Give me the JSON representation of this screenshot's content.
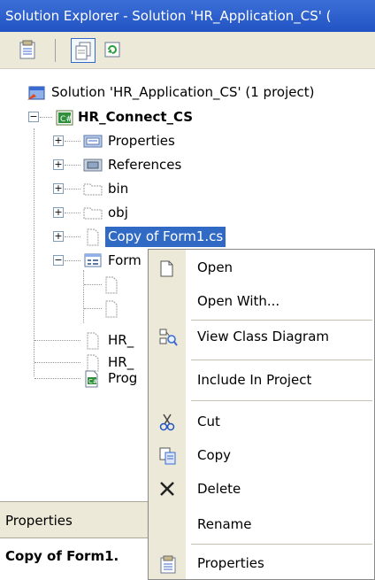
{
  "window": {
    "title": "Solution Explorer - Solution 'HR_Application_CS' ("
  },
  "toolbar": {
    "buttons": [
      {
        "icon": "properties-icon"
      },
      {
        "icon": "show-all-files-icon",
        "pressed": true
      },
      {
        "icon": "refresh-icon"
      }
    ]
  },
  "tree": {
    "solution": "Solution 'HR_Application_CS' (1 project)",
    "project": "HR_Connect_CS",
    "items": [
      "Properties",
      "References",
      "bin",
      "obj",
      "Copy of Form1.cs",
      "Form",
      "",
      "",
      "HR_",
      "HR_",
      "Prog"
    ]
  },
  "context_menu": {
    "items": [
      "Open",
      "Open With...",
      "View Class Diagram",
      "Include In Project",
      "Cut",
      "Copy",
      "Delete",
      "Rename",
      "Properties"
    ]
  },
  "properties_panel": {
    "title": "Properties",
    "object": "Copy of Form1."
  },
  "colors": {
    "titlebar": "#2a5ccc",
    "selection": "#316ac5",
    "chrome": "#ece9d8"
  }
}
